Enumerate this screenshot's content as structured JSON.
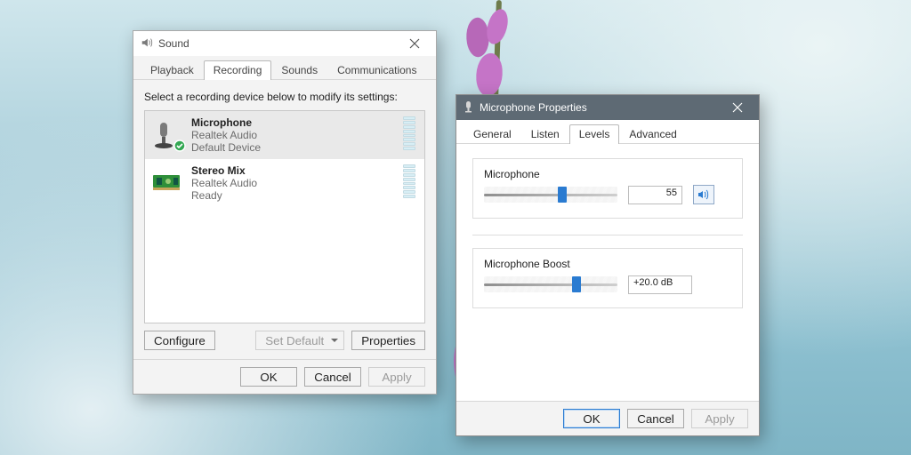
{
  "common": {
    "ok": "OK",
    "cancel": "Cancel",
    "apply": "Apply"
  },
  "sound": {
    "title": "Sound",
    "tabs": [
      "Playback",
      "Recording",
      "Sounds",
      "Communications"
    ],
    "active_tab": "Recording",
    "instruction": "Select a recording device below to modify its settings:",
    "devices": [
      {
        "name": "Microphone",
        "driver": "Realtek Audio",
        "status": "Default Device",
        "selected": true,
        "default": true
      },
      {
        "name": "Stereo Mix",
        "driver": "Realtek Audio",
        "status": "Ready",
        "selected": false,
        "default": false
      }
    ],
    "buttons": {
      "configure": "Configure",
      "setdefault": "Set Default",
      "setdefault_enabled": false,
      "properties": "Properties"
    },
    "apply_enabled": false
  },
  "mic": {
    "title": "Microphone Properties",
    "tabs": [
      "General",
      "Listen",
      "Levels",
      "Advanced"
    ],
    "active_tab": "Levels",
    "levels": {
      "mic": {
        "label": "Microphone",
        "value": "55",
        "percent": 55,
        "muted": false
      },
      "boost": {
        "label": "Microphone Boost",
        "value": "+20.0 dB",
        "db": 20.0
      }
    },
    "apply_enabled": false,
    "ok_highlighted": true
  }
}
